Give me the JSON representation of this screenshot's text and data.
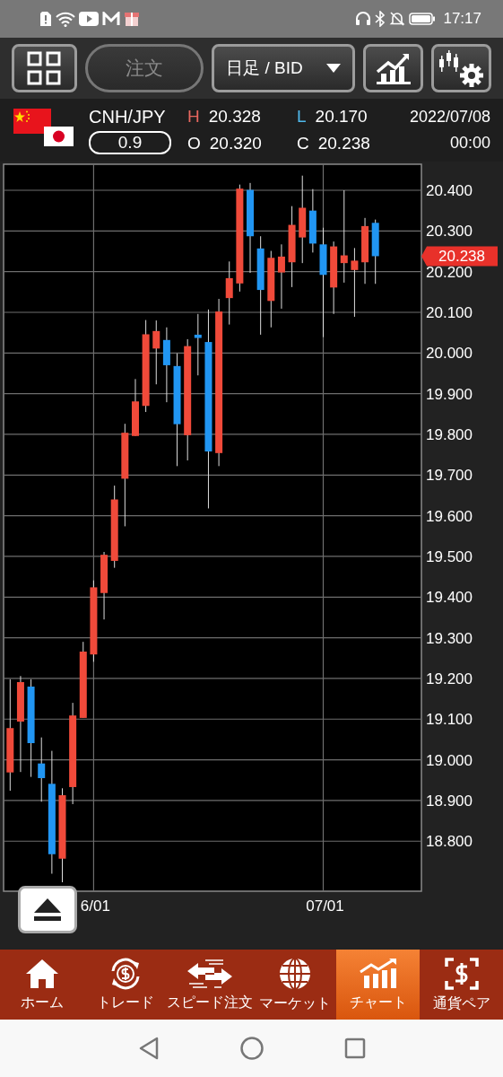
{
  "status_bar": {
    "time": "17:17"
  },
  "toolbar": {
    "order_button": {
      "label": "注文",
      "disabled": true
    },
    "period_dropdown": {
      "value": "日足 / BID"
    }
  },
  "quote": {
    "pair": "CNH/JPY",
    "spread": "0.9",
    "date": "2022/07/08",
    "time": "00:00",
    "prices": [
      {
        "label": "H",
        "value": "20.328",
        "color": "#e8675f"
      },
      {
        "label": "L",
        "value": "20.170",
        "color": "#4fb8ea"
      },
      {
        "label": "O",
        "value": "20.320",
        "color": "#ffffff"
      },
      {
        "label": "C",
        "value": "20.238",
        "color": "#ffffff"
      }
    ]
  },
  "chart": {
    "chart_data": {
      "type": "candlestick",
      "categories": [
        null,
        null,
        null,
        null,
        null,
        null,
        null,
        null,
        "6/01",
        null,
        null,
        null,
        null,
        null,
        null,
        null,
        null,
        null,
        null,
        null,
        null,
        null,
        null,
        null,
        null,
        null,
        null,
        null,
        null,
        null,
        "07/01",
        null,
        null,
        null,
        null,
        null
      ],
      "ylim": [
        18.677,
        20.464
      ],
      "grid": true,
      "yticks": [
        {
          "value": 20.4,
          "label": "20.400"
        },
        {
          "value": 20.3,
          "label": "20.300"
        },
        {
          "value": 20.2,
          "label": "20.200"
        },
        {
          "value": 20.1,
          "label": "20.100"
        },
        {
          "value": 20.0,
          "label": "20.000"
        },
        {
          "value": 19.9,
          "label": "19.900"
        },
        {
          "value": 19.8,
          "label": "19.800"
        },
        {
          "value": 19.7,
          "label": "19.700"
        },
        {
          "value": 19.6,
          "label": "19.600"
        },
        {
          "value": 19.5,
          "label": "19.500"
        },
        {
          "value": 19.4,
          "label": "19.400"
        },
        {
          "value": 19.3,
          "label": "19.300"
        },
        {
          "value": 19.2,
          "label": "19.200"
        },
        {
          "value": 19.1,
          "label": "19.100"
        },
        {
          "value": 19.0,
          "label": "19.000"
        },
        {
          "value": 18.9,
          "label": "18.900"
        },
        {
          "value": 18.8,
          "label": "18.800"
        }
      ],
      "ohlc": [
        [
          18.969,
          19.198,
          18.924,
          19.078
        ],
        [
          19.094,
          19.206,
          18.97,
          19.191
        ],
        [
          19.18,
          19.198,
          18.958,
          19.041
        ],
        [
          18.991,
          19.055,
          18.897,
          18.955
        ],
        [
          18.941,
          19.022,
          18.72,
          18.768
        ],
        [
          18.757,
          18.93,
          18.699,
          18.913
        ],
        [
          18.933,
          19.14,
          18.891,
          19.109
        ],
        [
          19.103,
          19.29,
          19.103,
          19.266
        ],
        [
          19.259,
          19.441,
          19.241,
          19.424
        ],
        [
          19.41,
          19.511,
          19.345,
          19.504
        ],
        [
          19.489,
          19.674,
          19.472,
          19.64
        ],
        [
          19.691,
          19.826,
          19.574,
          19.804
        ],
        [
          19.796,
          19.936,
          19.796,
          19.881
        ],
        [
          19.87,
          20.081,
          19.855,
          20.046
        ],
        [
          20.011,
          20.08,
          19.923,
          20.054
        ],
        [
          20.032,
          20.063,
          19.879,
          19.97
        ],
        [
          19.968,
          19.999,
          19.722,
          19.825
        ],
        [
          19.798,
          20.034,
          19.736,
          20.017
        ],
        [
          20.045,
          20.096,
          19.945,
          20.037
        ],
        [
          20.027,
          20.107,
          19.618,
          19.758
        ],
        [
          19.754,
          20.133,
          19.722,
          20.102
        ],
        [
          20.135,
          20.225,
          20.07,
          20.184
        ],
        [
          20.171,
          20.414,
          20.151,
          20.404
        ],
        [
          20.401,
          20.418,
          20.197,
          20.287
        ],
        [
          20.257,
          20.287,
          20.045,
          20.155
        ],
        [
          20.128,
          20.251,
          20.063,
          20.234
        ],
        [
          20.198,
          20.267,
          20.109,
          20.237
        ],
        [
          20.223,
          20.361,
          20.162,
          20.315
        ],
        [
          20.284,
          20.436,
          20.221,
          20.357
        ],
        [
          20.35,
          20.403,
          20.247,
          20.269
        ],
        [
          20.267,
          20.308,
          20.039,
          20.192
        ],
        [
          20.161,
          20.274,
          20.096,
          20.262
        ],
        [
          20.221,
          20.4,
          20.173,
          20.24
        ],
        [
          20.204,
          20.258,
          20.089,
          20.227
        ],
        [
          20.223,
          20.332,
          20.17,
          20.312
        ],
        [
          20.32,
          20.328,
          20.17,
          20.238
        ]
      ]
    },
    "current_price": "20.238"
  },
  "bottom_nav": [
    {
      "label": "ホーム",
      "selected": false
    },
    {
      "label": "トレード",
      "selected": false
    },
    {
      "label": "スピード注文",
      "selected": false
    },
    {
      "label": "マーケット",
      "selected": false
    },
    {
      "label": "チャート",
      "selected": true
    },
    {
      "label": "通貨ペア",
      "selected": false
    }
  ]
}
